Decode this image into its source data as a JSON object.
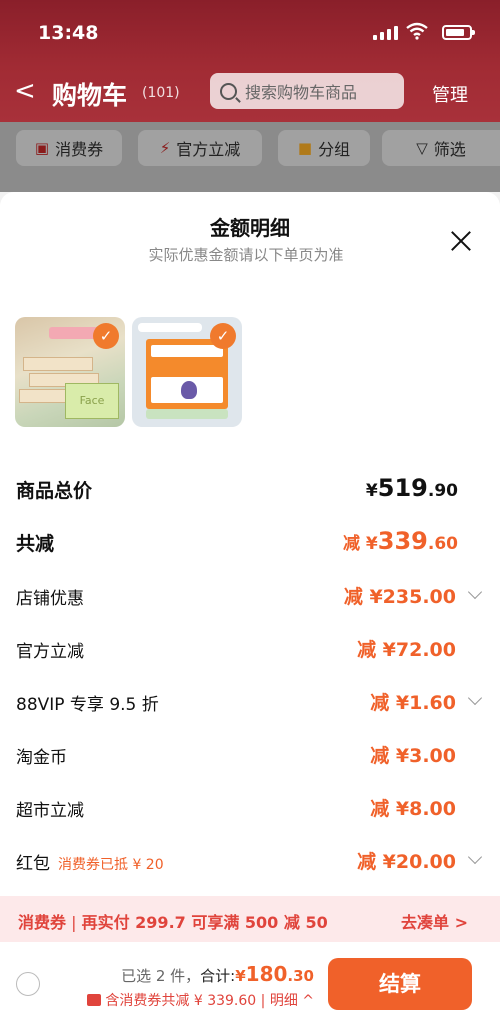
{
  "status": {
    "time": "13:48"
  },
  "nav": {
    "back": "<",
    "title": "购物车",
    "count": "(101)",
    "search_placeholder": "搜索购物车商品",
    "manage": "管理"
  },
  "chips": [
    {
      "icon": "ticket-icon",
      "label": "消费券"
    },
    {
      "icon": "lightning-icon",
      "label": "官方立减"
    },
    {
      "icon": "folder-icon",
      "label": "分组"
    },
    {
      "icon": "funnel-icon",
      "label": "筛选"
    }
  ],
  "sheet": {
    "title": "金额明细",
    "subtitle": "实际优惠金额请以下单页为准",
    "total_label": "商品总价",
    "total_prefix": "¥",
    "total_int": "519",
    "total_dec": ".90",
    "discount_label": "共减",
    "discount_prefix": "减 ¥",
    "discount_int": "339",
    "discount_dec": ".60",
    "items": [
      {
        "label": "店铺优惠",
        "value": "减 ¥235.00",
        "note": "",
        "expandable": true
      },
      {
        "label": "官方立减",
        "value": "减 ¥72.00",
        "note": "",
        "expandable": false
      },
      {
        "label": "88VIP 专享 9.5 折",
        "value": "减 ¥1.60",
        "note": "",
        "expandable": true
      },
      {
        "label": "淘金币",
        "value": "减 ¥3.00",
        "note": "",
        "expandable": false
      },
      {
        "label": "超市立减",
        "value": "减 ¥8.00",
        "note": "",
        "expandable": false
      },
      {
        "label": "红包",
        "value": "减 ¥20.00",
        "note": "消费券已抵 ¥ 20",
        "expandable": true
      }
    ]
  },
  "coupon_bar": {
    "tag": "消费券",
    "sep": "|",
    "text": "再实付 299.7 可享满 500 减 50",
    "action": "去凑单 >"
  },
  "bottom": {
    "selected": "已选 2 件，",
    "total_label": "合计:",
    "amount_prefix": "¥",
    "amount_int": "180",
    "amount_dec": ".30",
    "saved": "含消费券共减 ¥ 339.60 | 明细 ^",
    "checkout": "结算"
  }
}
